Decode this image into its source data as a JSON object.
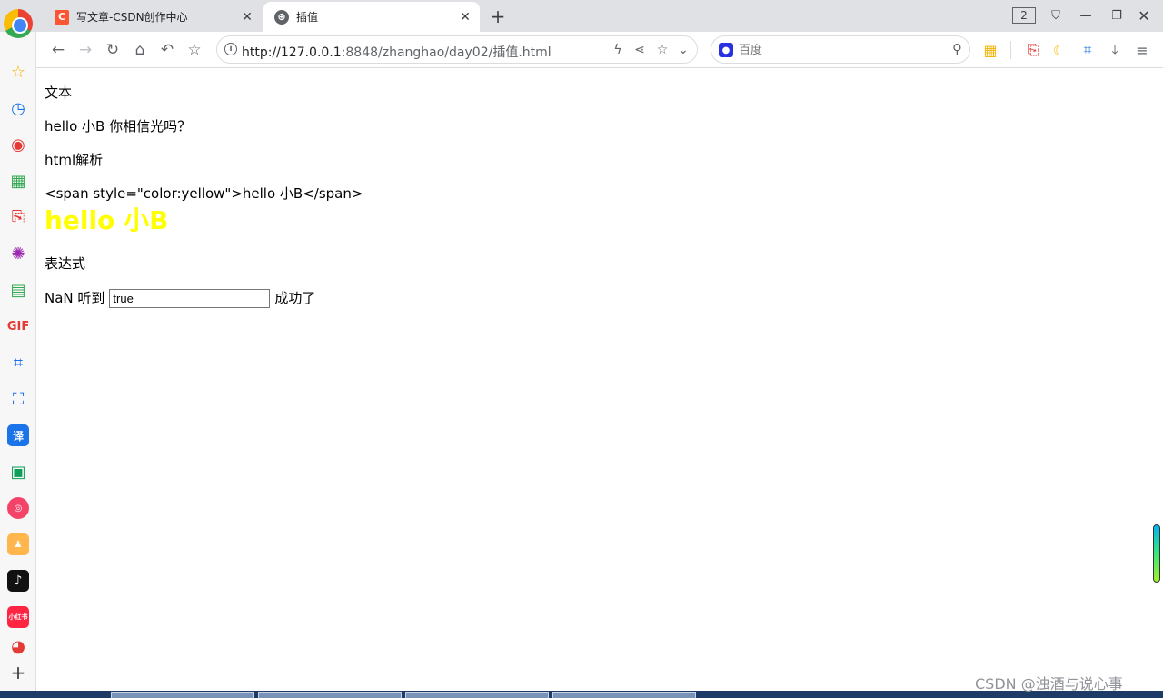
{
  "tabs": [
    {
      "title": "写文章-CSDN创作中心",
      "favicon": "csdn-icon",
      "favicon_text": "C"
    },
    {
      "title": "插值",
      "favicon": "globe-icon",
      "favicon_text": "⊕"
    }
  ],
  "window": {
    "tab_count": "2"
  },
  "toolbar": {
    "url_host": "http://127.0.0.1",
    "url_rest": ":8848/zhanghao/day02/插值.html",
    "search_placeholder": "百度"
  },
  "page": {
    "line1": "文本",
    "line2": "hello 小B 你相信光吗？",
    "line3": "html解析",
    "line4": "<span style=\"color:yellow\">hello 小B</span>",
    "rendered_html": "hello 小B",
    "line5": "表达式",
    "expr_prefix": "NaN 听到",
    "input_value": "true",
    "expr_suffix": "成功了",
    "highlight_color": "#ffff00"
  },
  "watermark": "CSDN @浊酒与说心事"
}
